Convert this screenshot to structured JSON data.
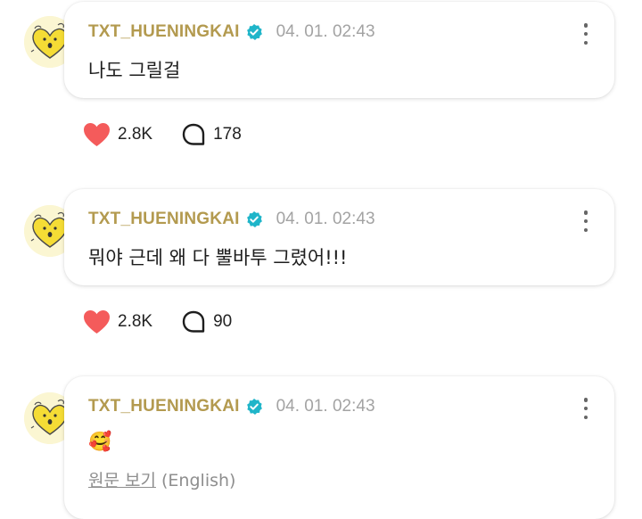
{
  "posts": [
    {
      "author": "TXT_HUENINGKAI",
      "time": "04. 01. 02:43",
      "content": "나도 그릴걸",
      "likes": "2.8K",
      "comments": "178"
    },
    {
      "author": "TXT_HUENINGKAI",
      "time": "04. 01. 02:43",
      "content": "뭐야 근데 왜 다 뿔바투 그렸어!!!",
      "likes": "2.8K",
      "comments": "90"
    },
    {
      "author": "TXT_HUENINGKAI",
      "time": "04. 01. 02:43",
      "content": "🥰",
      "translate_link": "원문 보기",
      "translate_lang": "(English)"
    }
  ],
  "colors": {
    "author": "#b39a4f",
    "time": "#a3a3a3",
    "heart": "#f45b5b",
    "verified": "#1fb5c9",
    "avatar_bg": "#fbf6d2",
    "avatar_heart": "#f5dc35"
  },
  "icons": [
    "verified-badge-icon",
    "more-options-icon",
    "heart-icon",
    "comment-bubble-icon"
  ]
}
